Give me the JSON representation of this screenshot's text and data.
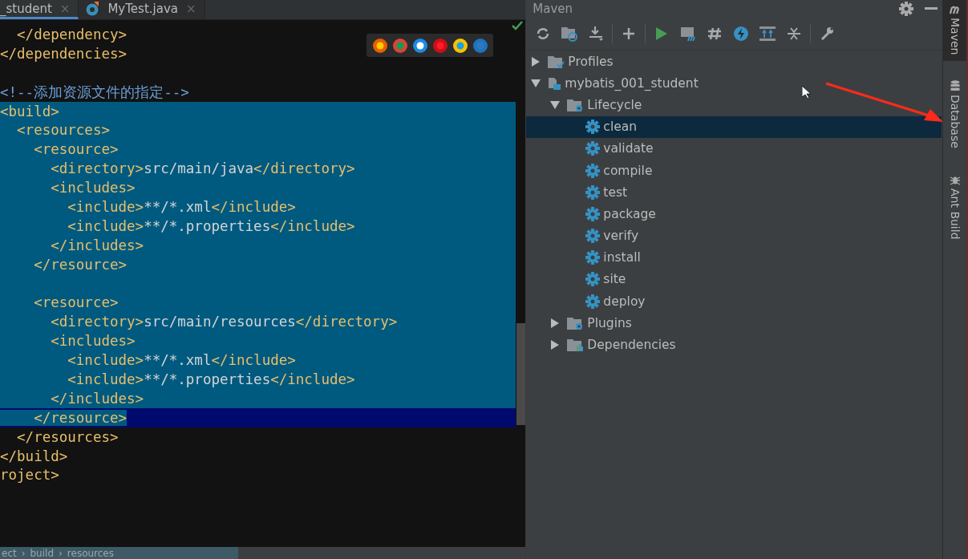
{
  "editor": {
    "tabs": [
      {
        "label": "_student",
        "selected": true,
        "close": "×"
      },
      {
        "label": "MyTest.java",
        "selected": false,
        "close": "×"
      }
    ],
    "lines": [
      {
        "kind": "code",
        "segments": [
          {
            "kind": "tag",
            "text": "  </dependency>"
          }
        ]
      },
      {
        "kind": "code",
        "segments": [
          {
            "kind": "tag",
            "text": "</dependencies>"
          }
        ]
      },
      {
        "kind": "blank"
      },
      {
        "kind": "code",
        "segments": [
          {
            "kind": "comment",
            "text": "<!--添加资源文件的指定-->"
          }
        ]
      },
      {
        "kind": "code",
        "selected": true,
        "current": false,
        "segments": [
          {
            "kind": "tag",
            "text": "<build>"
          }
        ]
      },
      {
        "kind": "code",
        "selected": true,
        "current": false,
        "segments": [
          {
            "kind": "tag",
            "text": "  <resources>"
          }
        ]
      },
      {
        "kind": "code",
        "selected": true,
        "current": false,
        "segments": [
          {
            "kind": "tag",
            "text": "    <resource>"
          }
        ]
      },
      {
        "kind": "code",
        "selected": true,
        "current": false,
        "segments": [
          {
            "kind": "tag",
            "text": "      <directory>"
          },
          {
            "kind": "text",
            "text": "src/main/java"
          },
          {
            "kind": "tag",
            "text": "</directory>"
          }
        ]
      },
      {
        "kind": "code",
        "selected": true,
        "current": false,
        "segments": [
          {
            "kind": "tag",
            "text": "      <includes>"
          }
        ]
      },
      {
        "kind": "code",
        "selected": true,
        "current": false,
        "segments": [
          {
            "kind": "tag",
            "text": "        <include>"
          },
          {
            "kind": "text",
            "text": "**/*.xml"
          },
          {
            "kind": "tag",
            "text": "</include>"
          }
        ]
      },
      {
        "kind": "code",
        "selected": true,
        "current": false,
        "segments": [
          {
            "kind": "tag",
            "text": "        <include>"
          },
          {
            "kind": "text",
            "text": "**/*.properties"
          },
          {
            "kind": "tag",
            "text": "</include>"
          }
        ]
      },
      {
        "kind": "code",
        "selected": true,
        "current": false,
        "segments": [
          {
            "kind": "tag",
            "text": "      </includes>"
          }
        ]
      },
      {
        "kind": "code",
        "selected": true,
        "current": false,
        "segments": [
          {
            "kind": "tag",
            "text": "    </resource>"
          }
        ]
      },
      {
        "kind": "blank",
        "selected": true,
        "current": false
      },
      {
        "kind": "code",
        "selected": true,
        "current": false,
        "segments": [
          {
            "kind": "tag",
            "text": "    <resource>"
          }
        ]
      },
      {
        "kind": "code",
        "selected": true,
        "current": false,
        "segments": [
          {
            "kind": "tag",
            "text": "      <directory>"
          },
          {
            "kind": "text",
            "text": "src/main/resources"
          },
          {
            "kind": "tag",
            "text": "</directory>"
          }
        ]
      },
      {
        "kind": "code",
        "selected": true,
        "current": false,
        "segments": [
          {
            "kind": "tag",
            "text": "      <includes>"
          }
        ]
      },
      {
        "kind": "code",
        "selected": true,
        "current": false,
        "segments": [
          {
            "kind": "tag",
            "text": "        <include>"
          },
          {
            "kind": "text",
            "text": "**/*.xml"
          },
          {
            "kind": "tag",
            "text": "</include>"
          }
        ]
      },
      {
        "kind": "code",
        "selected": true,
        "current": false,
        "segments": [
          {
            "kind": "tag",
            "text": "        <include>"
          },
          {
            "kind": "text",
            "text": "**/*.properties"
          },
          {
            "kind": "tag",
            "text": "</include>"
          }
        ]
      },
      {
        "kind": "code",
        "selected": true,
        "current": false,
        "segments": [
          {
            "kind": "tag",
            "text": "      </includes>"
          }
        ]
      },
      {
        "kind": "code",
        "selected": true,
        "current": true,
        "segments": [
          {
            "kind": "tag",
            "text": "    </resource>"
          }
        ]
      },
      {
        "kind": "code",
        "segments": [
          {
            "kind": "tag",
            "text": "  </resources>"
          }
        ]
      },
      {
        "kind": "code",
        "segments": [
          {
            "kind": "tag",
            "text": "</build>"
          }
        ]
      },
      {
        "kind": "code",
        "segments": [
          {
            "kind": "tag",
            "text": "roject>"
          }
        ]
      }
    ],
    "breadcrumbs": [
      "ect",
      "build",
      "resources"
    ],
    "separator": "›"
  },
  "maven": {
    "title": "Maven",
    "tree": [
      {
        "label": "Profiles",
        "kind": "profiles",
        "selected": false,
        "expanded": false
      },
      {
        "label": "mybatis_001_student",
        "kind": "project",
        "selected": false,
        "expanded": true,
        "children": [
          {
            "label": "Lifecycle",
            "kind": "lifecycle",
            "selected": false,
            "expanded": true,
            "children": [
              {
                "label": "clean",
                "kind": "goal",
                "selected": true
              },
              {
                "label": "validate",
                "kind": "goal",
                "selected": false
              },
              {
                "label": "compile",
                "kind": "goal",
                "selected": false
              },
              {
                "label": "test",
                "kind": "goal",
                "selected": false
              },
              {
                "label": "package",
                "kind": "goal",
                "selected": false
              },
              {
                "label": "verify",
                "kind": "goal",
                "selected": false
              },
              {
                "label": "install",
                "kind": "goal",
                "selected": false
              },
              {
                "label": "site",
                "kind": "goal",
                "selected": false
              },
              {
                "label": "deploy",
                "kind": "goal",
                "selected": false
              }
            ]
          },
          {
            "label": "Plugins",
            "kind": "plugins",
            "selected": false,
            "expanded": false
          },
          {
            "label": "Dependencies",
            "kind": "dependencies",
            "selected": false,
            "expanded": false
          }
        ]
      }
    ]
  },
  "tool_strip": [
    {
      "label": "Maven",
      "kind": "maven",
      "selected": true
    },
    {
      "label": "Database",
      "kind": "database",
      "selected": false
    },
    {
      "label": "Ant Build",
      "kind": "ant",
      "selected": false
    }
  ]
}
